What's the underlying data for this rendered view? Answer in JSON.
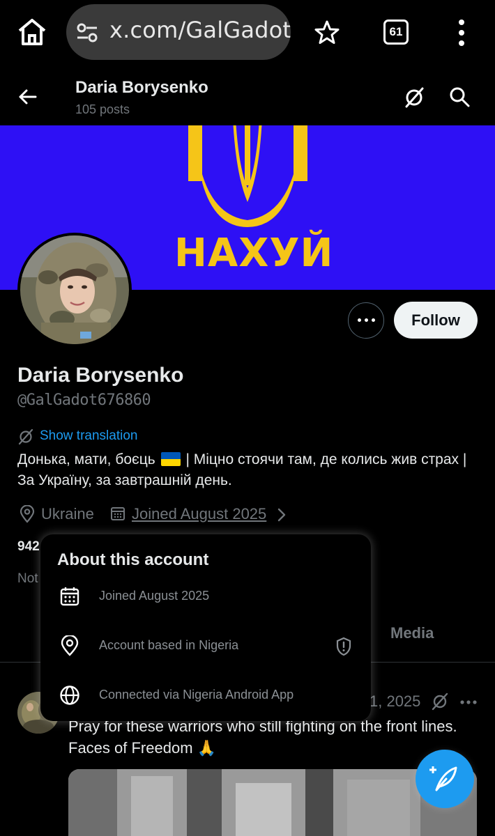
{
  "browser": {
    "url": "x.com/GalGadot",
    "tab_count": "61",
    "icons": [
      "home-icon",
      "site-settings-icon",
      "star-icon",
      "tabs-icon",
      "more-vert-icon"
    ]
  },
  "header": {
    "title": "Daria Borysenko",
    "post_count": "105 posts",
    "icons": [
      "back-arrow-icon",
      "grok-icon",
      "search-icon"
    ]
  },
  "banner": {
    "text": "НАХУЙ",
    "background_color": "#2e10f5",
    "emblem_color": "#f5c518"
  },
  "profile": {
    "display_name": "Daria Borysenko",
    "handle": "@GalGadot676860",
    "follow_label": "Follow",
    "show_translation_label": "Show translation",
    "bio_part1": "Донька, мати, боєць",
    "bio_part2": "| Міцно стоячи там, де колись жив страх | За Україну, за завтрашній день.",
    "location": "Ukraine",
    "joined": "Joined August 2025",
    "count_fragment": "942",
    "not_fragment": "Not"
  },
  "tabs": {
    "media": "Media"
  },
  "post": {
    "date": "1, 2025",
    "text_line1": "Pray for these warriors who still fighting on the front lines.",
    "text_line2": "Faces of Freedom 🙏"
  },
  "popup": {
    "title": "About this account",
    "joined": "Joined August 2025",
    "based_in": "Account based in Nigeria",
    "connected_via": "Connected via Nigeria Android App"
  },
  "colors": {
    "accent": "#1d9bf0",
    "muted_text": "#71767b",
    "flag_blue": "#0057b7",
    "flag_yellow": "#ffd700"
  }
}
